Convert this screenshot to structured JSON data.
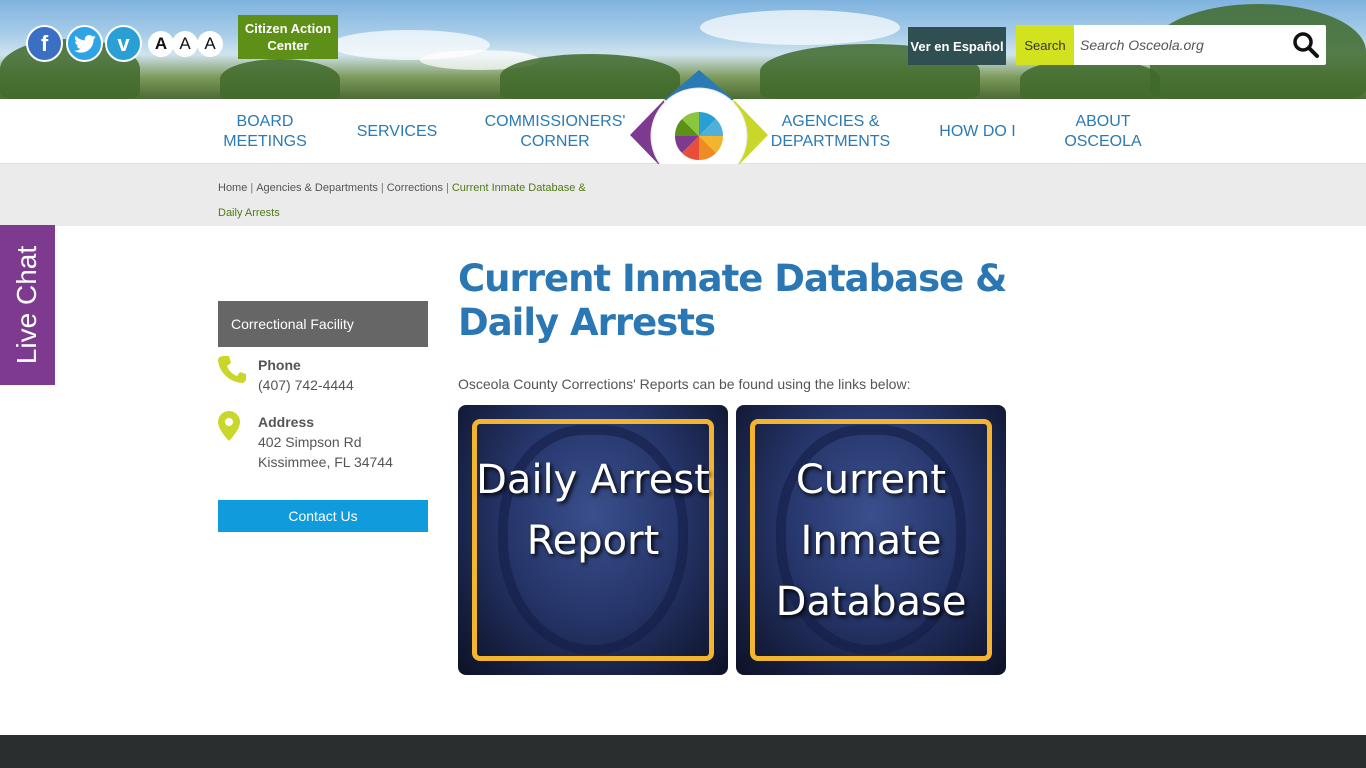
{
  "header": {
    "social": [
      {
        "name": "facebook",
        "glyph": "f"
      },
      {
        "name": "twitter",
        "glyph": "t"
      },
      {
        "name": "vimeo",
        "glyph": "v"
      }
    ],
    "text_size_options": [
      "A",
      "A",
      "A"
    ],
    "citizen_action_center": "Citizen Action Center",
    "espanol": "Ver en Español",
    "search": {
      "label": "Search",
      "placeholder": "Search Osceola.org"
    }
  },
  "nav": {
    "items": [
      "BOARD MEETINGS",
      "SERVICES",
      "COMMISSIONERS' CORNER",
      "AGENCIES & DEPARTMENTS",
      "HOW DO I",
      "ABOUT OSCEOLA"
    ]
  },
  "breadcrumb": {
    "items": [
      "Home",
      "Agencies & Departments",
      "Corrections"
    ],
    "current": "Current Inmate Database & Daily Arrests"
  },
  "live_chat": "Live Chat",
  "sidebar": {
    "heading": "Correctional Facility",
    "phone_label": "Phone",
    "phone_value": "(407) 742-4444",
    "address_label": "Address",
    "address_line1": "402 Simpson Rd",
    "address_line2": "Kissimmee, FL 34744",
    "contact_button": "Contact Us"
  },
  "main": {
    "title": "Current Inmate Database & Daily Arrests",
    "intro": "Osceola County Corrections' Reports can be found using the links below:",
    "tiles": [
      {
        "label": "Daily Arrest Report"
      },
      {
        "label": "Current Inmate Database"
      }
    ]
  },
  "colors": {
    "brand_blue": "#2a77b3",
    "brand_green": "#5e8f16",
    "accent_yellow": "#d3e21f",
    "live_chat_purple": "#7d3a8f",
    "contact_blue": "#0f9bdc"
  }
}
